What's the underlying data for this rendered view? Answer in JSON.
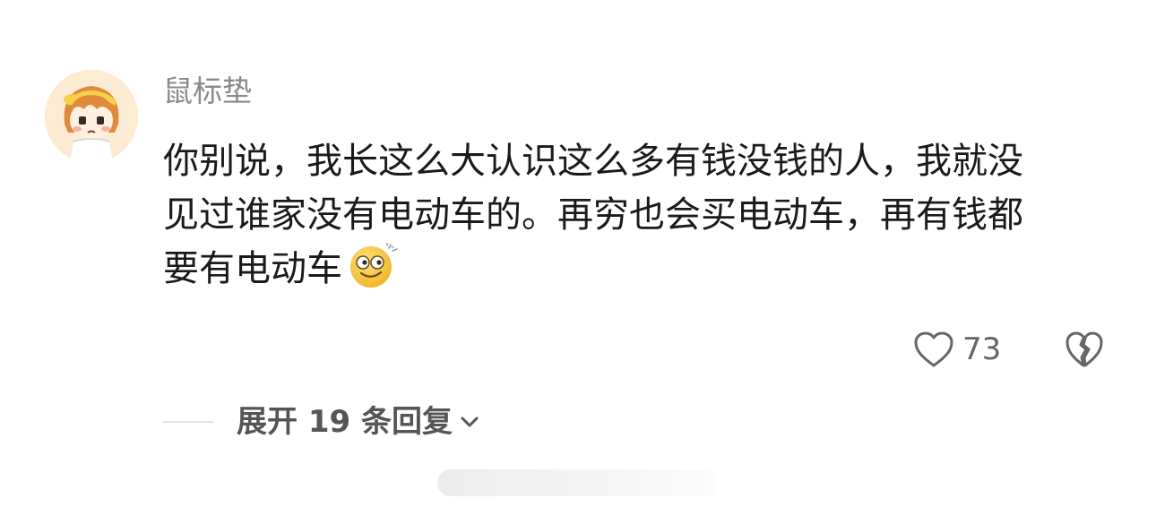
{
  "comment": {
    "username": "鼠标垫",
    "text_lines": [
      "你别说，我长这么大认识这么多有钱没钱的人，我就没",
      "见过谁家没有电动车的。再穷也会买电动车，再有钱都",
      "要有电动车"
    ],
    "inline_emoji": "dizzy-smile-emoji",
    "like_icon": "heart-outline-icon",
    "like_count": "73",
    "dislike_icon": "broken-heart-icon"
  },
  "replies": {
    "expand_label": "展开 19 条回复",
    "chevron_icon": "chevron-down-icon"
  },
  "colors": {
    "background": "#ffffff",
    "username": "#8a8a8a",
    "body_text": "#1a1a1a",
    "meta_gray": "#666666",
    "emoji_yellow": "#f9c93a"
  }
}
